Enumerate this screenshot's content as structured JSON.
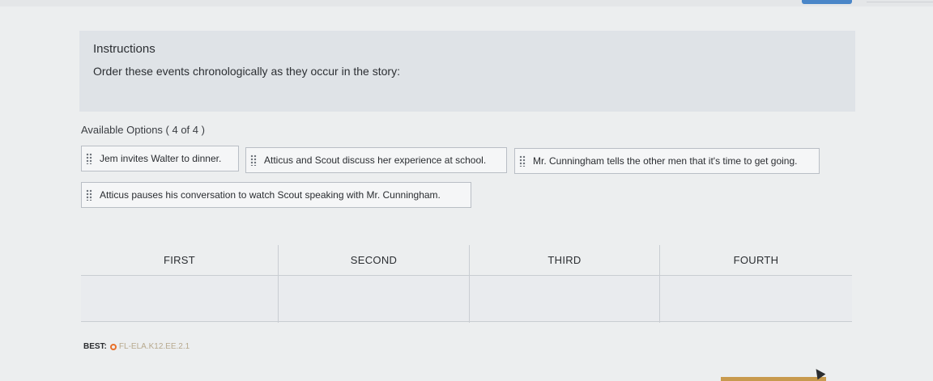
{
  "instructions": {
    "title": "Instructions",
    "text": "Order these events chronologically as they occur in the story:"
  },
  "available": {
    "label": "Available Options ( 4 of 4 )",
    "options": [
      "Jem invites Walter to dinner.",
      "Atticus and Scout discuss her experience at school.",
      "Mr. Cunningham tells the other men that it's time to get going.",
      "Atticus pauses his conversation to watch Scout speaking with Mr. Cunningham."
    ]
  },
  "slots": [
    "FIRST",
    "SECOND",
    "THIRD",
    "FOURTH"
  ],
  "standard": {
    "label": "BEST:",
    "code": "FL-ELA.K12.EE.2.1"
  },
  "colors": {
    "accent": "#4a86c8",
    "best_icon": "#e8702a"
  }
}
